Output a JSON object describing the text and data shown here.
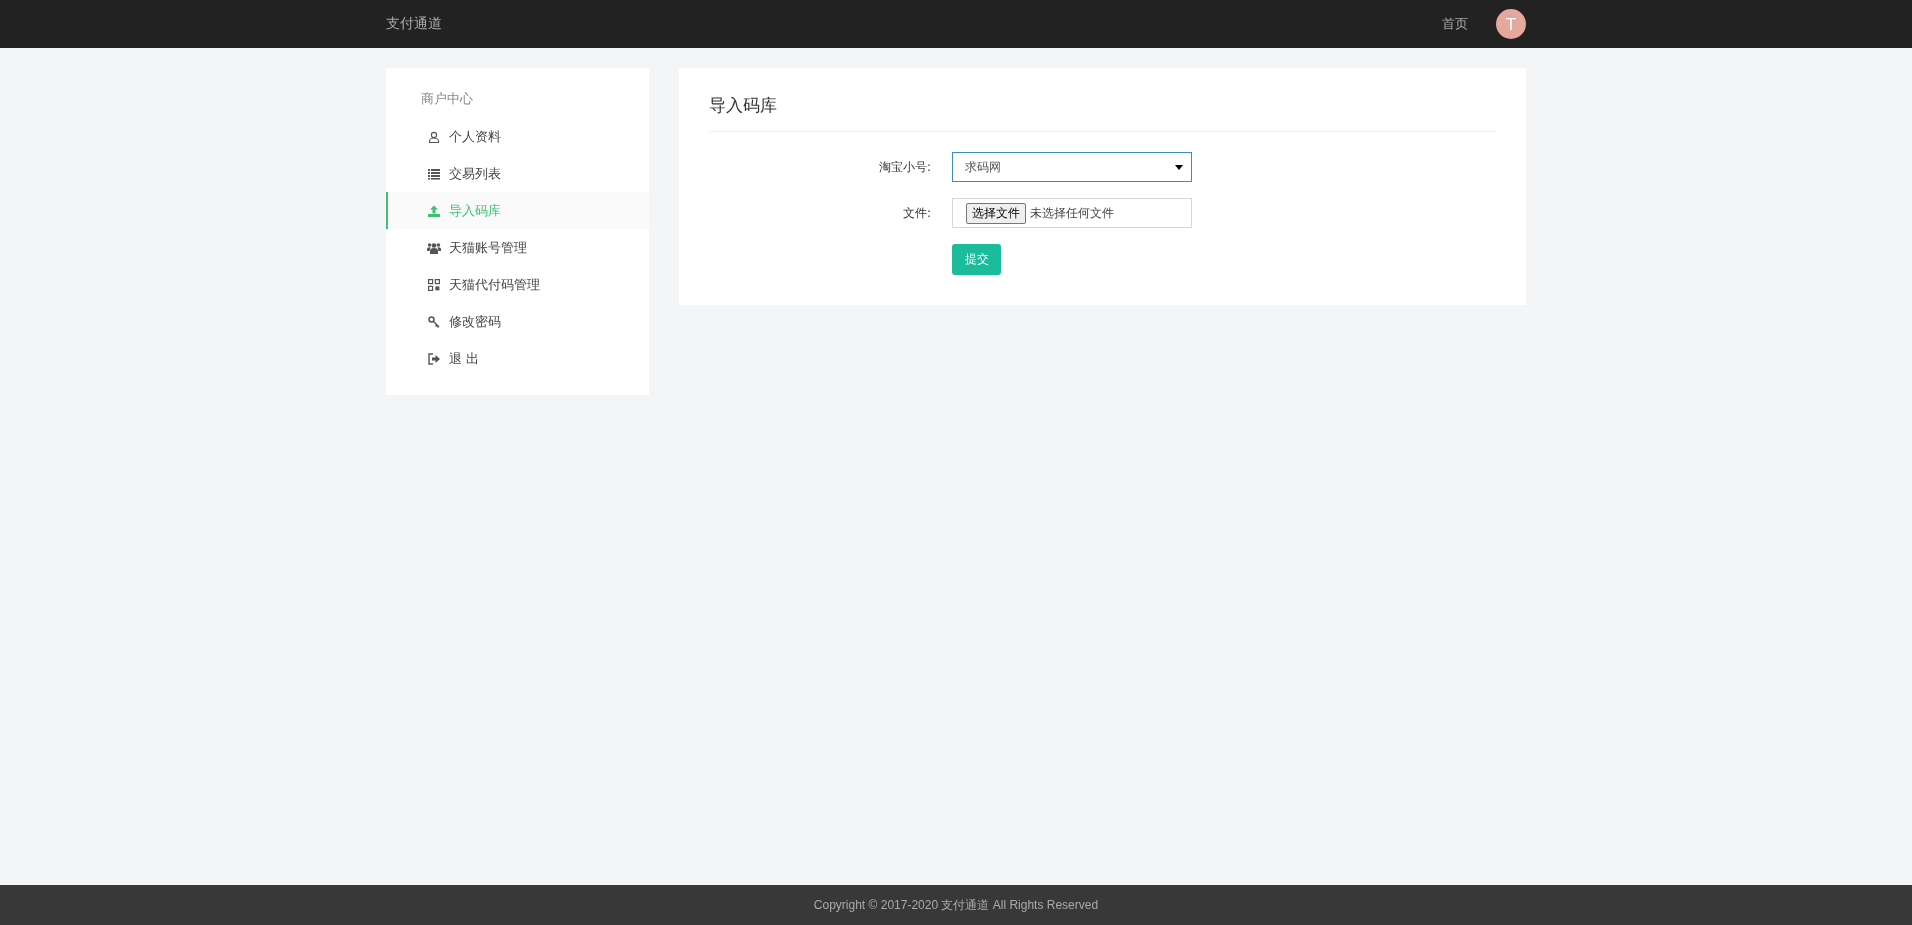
{
  "navbar": {
    "brand": "支付通道",
    "links": [
      "首页"
    ],
    "avatar": "T"
  },
  "sidebar": {
    "heading": "商户中心",
    "items": [
      {
        "label": "个人资料",
        "selected": false
      },
      {
        "label": "交易列表",
        "selected": false
      },
      {
        "label": "导入码库",
        "selected": true
      },
      {
        "label": "天猫账号管理",
        "selected": false
      },
      {
        "label": "天猫代付码管理",
        "selected": false
      },
      {
        "label": "修改密码",
        "selected": false
      },
      {
        "label": "退 出",
        "selected": false
      }
    ]
  },
  "panel": {
    "title": "导入码库",
    "form": {
      "account": {
        "label": "淘宝小号:",
        "value": "求码网"
      },
      "file": {
        "label": "文件:",
        "button": "选择文件",
        "status": "未选择任何文件"
      },
      "submit": "提交"
    }
  },
  "footer": {
    "copyright": "Copyright © 2017-2020 支付通道 All Rights Reserved"
  }
}
